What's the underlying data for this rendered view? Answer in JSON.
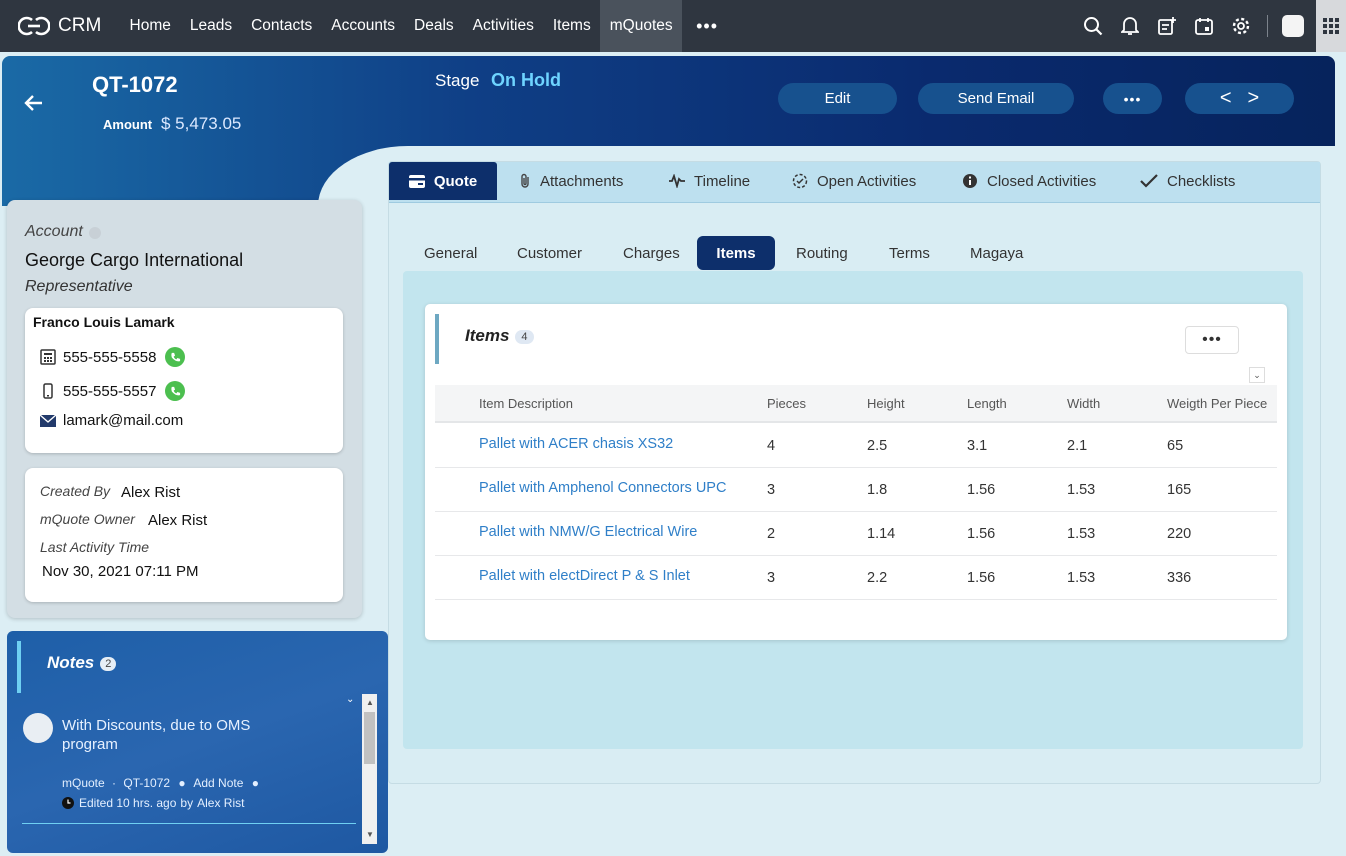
{
  "app": {
    "name": "CRM"
  },
  "nav": {
    "items": [
      "Home",
      "Leads",
      "Contacts",
      "Accounts",
      "Deals",
      "Activities",
      "Items",
      "mQuotes"
    ],
    "active": "mQuotes",
    "more": "•••"
  },
  "icons": {
    "top": [
      "search-icon",
      "bell-icon",
      "add-note-icon",
      "calendar-icon",
      "gear-icon",
      "avatar",
      "grid-icon"
    ]
  },
  "record": {
    "id": "QT-1072",
    "amount_label": "Amount",
    "amount_value": "$ 5,473.05",
    "stage_label": "Stage",
    "stage_value": "On Hold"
  },
  "actions": {
    "edit": "Edit",
    "send_email": "Send Email",
    "more": "•••",
    "prev": "<",
    "next": ">"
  },
  "account": {
    "label": "Account",
    "name": "George Cargo International",
    "rep_label": "Representative"
  },
  "contact": {
    "name": "Franco Louis Lamark",
    "phone": "555-555-5558",
    "mobile": "555-555-5557",
    "email": "lamark@mail.com"
  },
  "meta": {
    "created_by_label": "Created By",
    "created_by": "Alex Rist",
    "owner_label": "mQuote Owner",
    "owner": "Alex Rist",
    "last_activity_label": "Last Activity Time",
    "last_activity": "Nov 30, 2021 07:11 PM"
  },
  "notes": {
    "title": "Notes",
    "count": "2",
    "items": [
      {
        "text": "With Discounts, due to OMS program",
        "module": "mQuote",
        "record": "QT-1072",
        "add_note": "Add Note",
        "edited": "Edited 10 hrs. ago",
        "by_label": "by",
        "author": "Alex Rist"
      }
    ]
  },
  "tabs": [
    "Quote",
    "Attachments",
    "Timeline",
    "Open Activities",
    "Closed Activities",
    "Checklists"
  ],
  "subtabs": [
    "General",
    "Customer",
    "Charges",
    "Items",
    "Routing",
    "Terms",
    "Magaya"
  ],
  "items_section": {
    "title": "Items",
    "count": "4",
    "more": "•••",
    "columns": [
      "Item Description",
      "Pieces",
      "Height",
      "Length",
      "Width",
      "Weigth Per Piece"
    ],
    "rows": [
      [
        "Pallet with ACER chasis XS32",
        "4",
        "2.5",
        "3.1",
        "2.1",
        "65"
      ],
      [
        "Pallet with Amphenol Connectors UPC",
        "3",
        "1.8",
        "1.56",
        "1.53",
        "165"
      ],
      [
        "Pallet with NMW/G Electrical Wire",
        "2",
        "1.14",
        "1.56",
        "1.53",
        "220"
      ],
      [
        "Pallet with electDirect P & S Inlet",
        "3",
        "2.2",
        "1.56",
        "1.53",
        "336"
      ]
    ]
  }
}
